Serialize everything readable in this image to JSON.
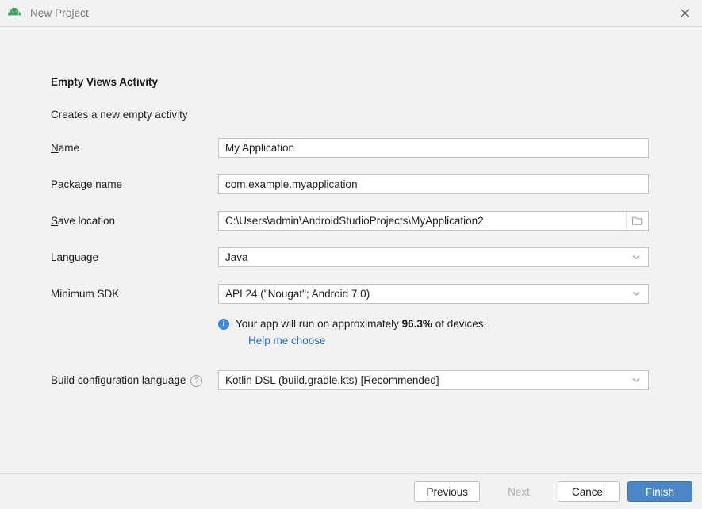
{
  "window": {
    "title": "New Project",
    "app_icon": "android-robot-icon",
    "close_icon": "close-icon"
  },
  "template": {
    "heading": "Empty Views Activity",
    "description": "Creates a new empty activity"
  },
  "form": {
    "name": {
      "label_pre": "",
      "label_mnemonic": "N",
      "label_post": "ame",
      "value": "My Application"
    },
    "package_name": {
      "label_pre": "",
      "label_mnemonic": "P",
      "label_post": "ackage name",
      "value": "com.example.myapplication"
    },
    "save_location": {
      "label_pre": "",
      "label_mnemonic": "S",
      "label_post": "ave location",
      "value": "C:\\Users\\admin\\AndroidStudioProjects\\MyApplication2",
      "browse_icon": "folder-icon"
    },
    "language": {
      "label_pre": "",
      "label_mnemonic": "L",
      "label_post": "anguage",
      "value": "Java",
      "chevron_icon": "chevron-down-icon"
    },
    "minimum_sdk": {
      "label": "Minimum SDK",
      "value": "API 24 (\"Nougat\"; Android 7.0)",
      "chevron_icon": "chevron-down-icon"
    },
    "device_info": {
      "icon": "info-icon",
      "text_before": "Your app will run on approximately",
      "percentage": "96.3%",
      "text_after": "of devices.",
      "link": "Help me choose"
    },
    "build_config_language": {
      "label": "Build configuration language",
      "help_icon": "question-mark-icon",
      "help_glyph": "?",
      "value": "Kotlin DSL (build.gradle.kts) [Recommended]",
      "chevron_icon": "chevron-down-icon"
    }
  },
  "footer": {
    "previous": "Previous",
    "next": "Next",
    "cancel": "Cancel",
    "finish": "Finish"
  },
  "colors": {
    "accent": "#4a86c8",
    "link": "#2a6cc4",
    "info": "#3b87e0",
    "android_green": "#3ddc84",
    "background": "#f2f2f2"
  }
}
